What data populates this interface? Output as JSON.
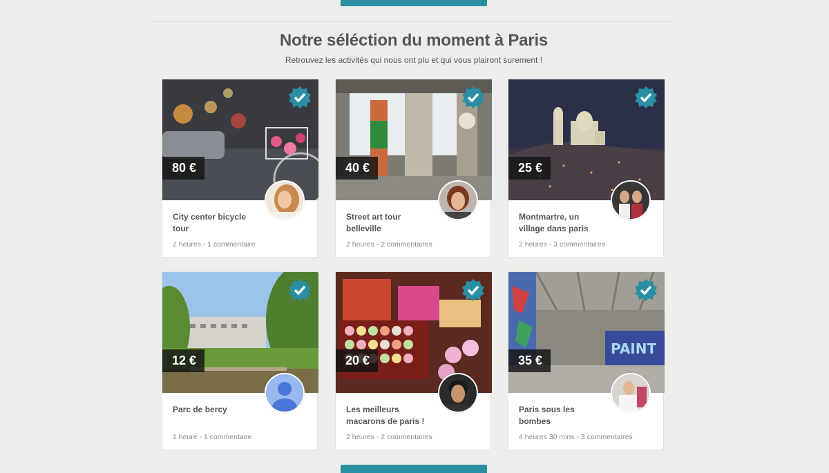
{
  "section": {
    "title": "Notre séléction du moment à Paris",
    "subtitle": "Retrouvez les activités qui nous ont plu et qui vous plairont surement !"
  },
  "colors": {
    "accent": "#2a8fa3",
    "background": "#edeeec"
  },
  "cards": [
    {
      "price": "80 €",
      "title": "City center bicycle tour",
      "meta": "2 heures - 1 commentaire"
    },
    {
      "price": "40 €",
      "title": "Street art tour belleville",
      "meta": "2 heures - 2 commentaires"
    },
    {
      "price": "25 €",
      "title": "Montmartre, un village dans paris",
      "meta": "2 heures - 3 commentaires"
    },
    {
      "price": "12 €",
      "title": "Parc de bercy",
      "meta": "1 heure - 1 commentaire"
    },
    {
      "price": "20 €",
      "title": "Les meilleurs macarons de paris !",
      "meta": "2 heures - 2 commentaires"
    },
    {
      "price": "35 €",
      "title": "Paris sous les bombes",
      "meta": "4 heures 30 mins - 3 commentaires"
    }
  ],
  "icons": {
    "verified": "verified-check-icon",
    "avatar": "user-avatar"
  }
}
